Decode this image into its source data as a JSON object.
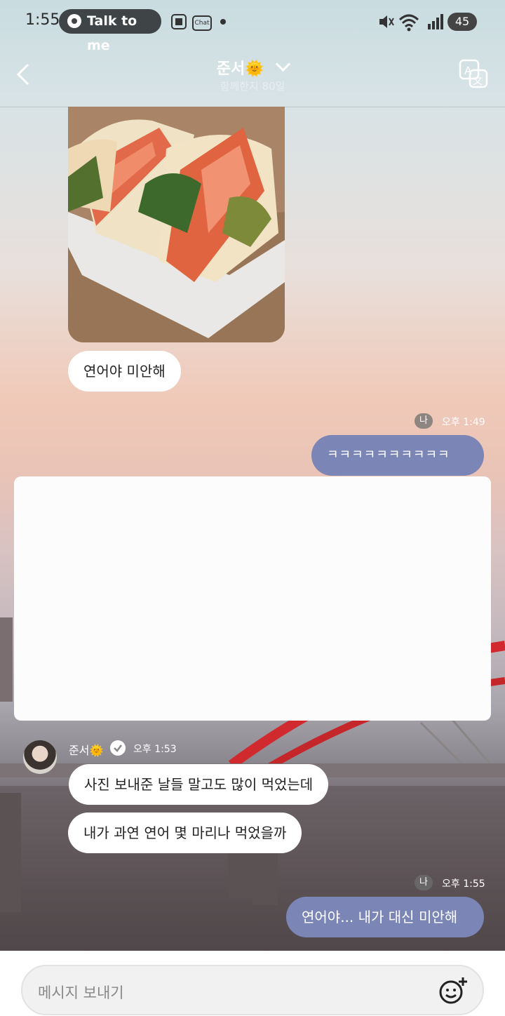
{
  "status": {
    "time": "1:55",
    "pill_label": "Talk to me",
    "battery": "45",
    "chat_icon_label": "Chat"
  },
  "header": {
    "title": "준서🌞",
    "subtitle": "함께한지 80일"
  },
  "messages": [
    {
      "side": "left",
      "text": "연어야 미안해"
    },
    {
      "side": "right",
      "badge": "나",
      "time": "오후 1:49",
      "text": "ㅋㅋㅋㅋㅋㅋㅋㅋㅋㅋ"
    },
    {
      "side": "left",
      "sender": "준서🌞",
      "time": "오후 1:53",
      "text": "사진 보내준 날들 말고도 많이 먹었는데"
    },
    {
      "side": "left",
      "text": "내가 과연 연어 몇 마리나 먹었을까"
    },
    {
      "side": "right",
      "badge": "나",
      "time": "오후 1:55",
      "text": "연어야... 내가 대신 미안해"
    }
  ],
  "composer": {
    "placeholder": "메시지 보내기"
  },
  "colors": {
    "right_bubble": "#7b85b6",
    "left_bubble": "#ffffff"
  }
}
